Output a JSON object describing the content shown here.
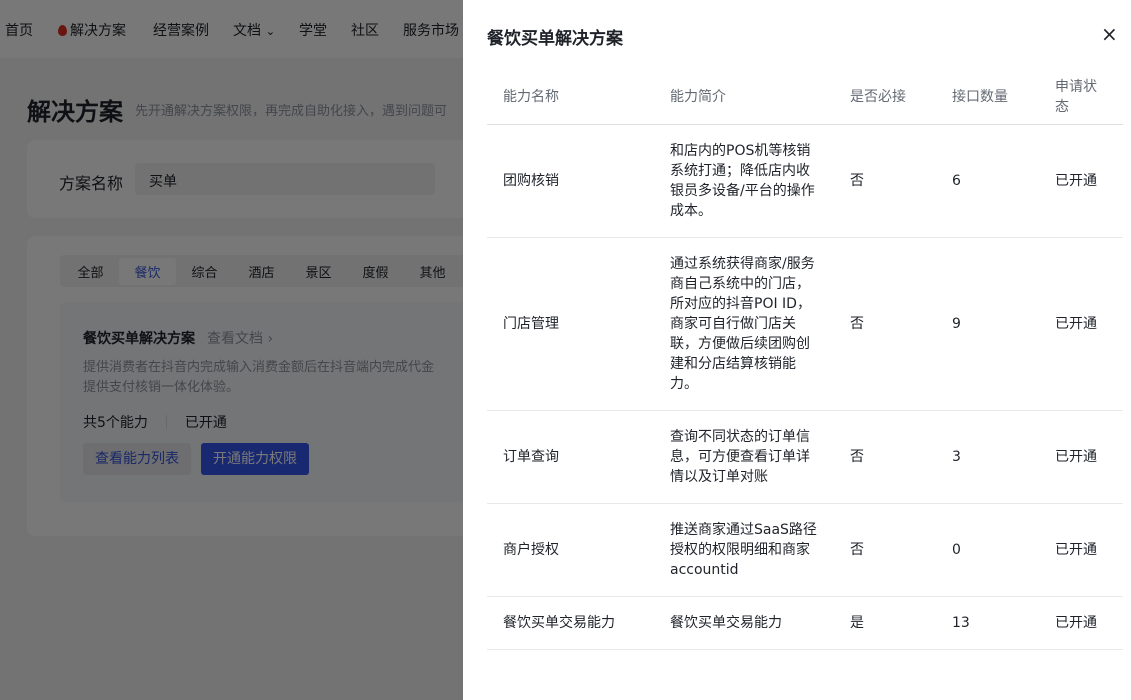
{
  "nav": {
    "items": [
      "首页",
      "解决方案",
      "经营案例",
      "文档",
      "学堂",
      "社区",
      "服务市场"
    ]
  },
  "page": {
    "title": "解决方案",
    "subtitle": "先开通解决方案权限，再完成自助化接入，遇到问题可"
  },
  "search": {
    "label": "方案名称",
    "value": "买单"
  },
  "categories": [
    "全部",
    "餐饮",
    "综合",
    "酒店",
    "景区",
    "度假",
    "其他"
  ],
  "solution": {
    "title": "餐饮买单解决方案",
    "doc_link": "查看文档 ›",
    "desc_line1": "提供消费者在抖音内完成输入消费金额后在抖音端内完成代金",
    "desc_line2": "提供支付核销一体化体验。",
    "count": "共5个能力",
    "status": "已开通",
    "view_button": "查看能力列表",
    "open_button": "开通能力权限"
  },
  "drawer": {
    "title": "餐饮买单解决方案",
    "close": "×",
    "columns": [
      "能力名称",
      "能力简介",
      "是否必接",
      "接口数量",
      "申请状态"
    ],
    "rows": [
      {
        "name": "团购核销",
        "desc": "和店内的POS机等核销系统打通；降低店内收银员多设备/平台的操作成本。",
        "required": "否",
        "count": "6",
        "status": "已开通"
      },
      {
        "name": "门店管理",
        "desc": "通过系统获得商家/服务商自己系统中的门店，所对应的抖音POI ID，商家可自行做门店关联，方便做后续团购创建和分店结算核销能力。",
        "required": "否",
        "count": "9",
        "status": "已开通"
      },
      {
        "name": "订单查询",
        "desc": "查询不同状态的订单信息，可方便查看订单详情以及订单对账",
        "required": "否",
        "count": "3",
        "status": "已开通"
      },
      {
        "name": "商户授权",
        "desc": "推送商家通过SaaS路径授权的权限明细和商家accountid",
        "required": "否",
        "count": "0",
        "status": "已开通"
      },
      {
        "name": "餐饮买单交易能力",
        "desc": "餐饮买单交易能力",
        "required": "是",
        "count": "13",
        "status": "已开通"
      }
    ]
  }
}
